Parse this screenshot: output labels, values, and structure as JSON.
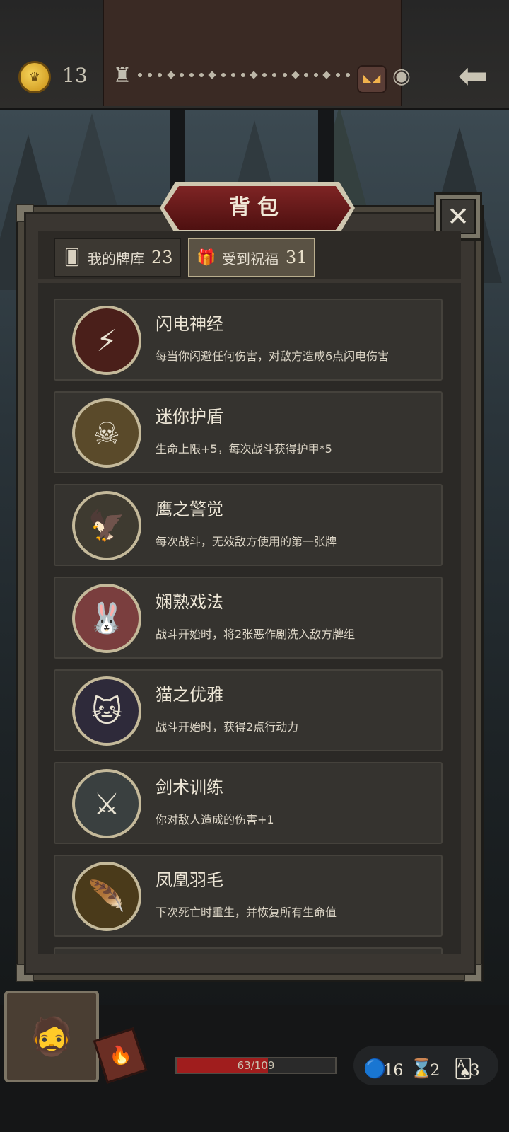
{
  "header": {
    "coins": "13",
    "coin_icon": "crown-coin-icon"
  },
  "panel": {
    "title": "背包",
    "close_label": "✕"
  },
  "tabs": [
    {
      "label": "我的牌库",
      "count": "23",
      "icon": "cards-icon",
      "active": false
    },
    {
      "label": "受到祝福",
      "count": "31",
      "icon": "gift-icon",
      "active": true
    }
  ],
  "blessings": [
    {
      "title": "闪电神经",
      "desc": "每当你闪避任何伤害，对敌方造成6点闪电伤害",
      "icon": "hooded-figure-lightning-icon"
    },
    {
      "title": "迷你护盾",
      "desc": "生命上限+5，每次战斗获得护甲*5",
      "icon": "skull-shield-icon"
    },
    {
      "title": "鹰之警觉",
      "desc": "每次战斗，无效敌方使用的第一张牌",
      "icon": "eagle-icon"
    },
    {
      "title": "娴熟戏法",
      "desc": "战斗开始时，将2张恶作剧洗入敌方牌组",
      "icon": "jester-rabbit-icon"
    },
    {
      "title": "猫之优雅",
      "desc": "战斗开始时，获得2点行动力",
      "icon": "witch-cat-icon"
    },
    {
      "title": "剑术训练",
      "desc": "你对敌人造成的伤害+1",
      "icon": "swordsman-icon"
    },
    {
      "title": "凤凰羽毛",
      "desc": "下次死亡时重生，并恢复所有生命值",
      "icon": "phoenix-feather-icon"
    }
  ],
  "status": {
    "hp_text": "63/109",
    "hp_current": 63,
    "hp_max": 109,
    "resources": [
      {
        "icon": "orb-icon",
        "value": "16"
      },
      {
        "icon": "hourglass-icon",
        "value": "2"
      },
      {
        "icon": "cards-stack-icon",
        "value": "3"
      }
    ]
  },
  "colors": {
    "accent_red": "#7e2424",
    "hp_red": "#a01d1d",
    "gold": "#f6d35a"
  }
}
